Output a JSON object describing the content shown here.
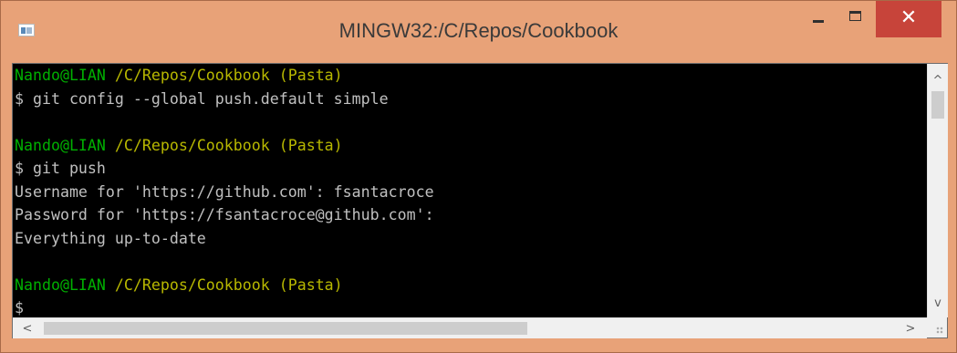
{
  "window": {
    "title": "MINGW32:/C/Repos/Cookbook",
    "icon": "terminal-app-icon",
    "controls": {
      "minimize": "minimize-icon",
      "maximize": "maximize-icon",
      "close": "✕"
    },
    "frame_color": "#e8a278",
    "close_color": "#c7443a"
  },
  "terminal": {
    "prompt_user": "Nando@LIAN",
    "prompt_path": "/C/Repos/Cookbook (Pasta)",
    "lines": [
      {
        "type": "prompt",
        "user": "Nando@LIAN",
        "path": "/C/Repos/Cookbook (Pasta)"
      },
      {
        "type": "text",
        "text": "$ git config --global push.default simple"
      },
      {
        "type": "blank",
        "text": ""
      },
      {
        "type": "prompt",
        "user": "Nando@LIAN",
        "path": "/C/Repos/Cookbook (Pasta)"
      },
      {
        "type": "text",
        "text": "$ git push"
      },
      {
        "type": "text",
        "text": "Username for 'https://github.com': fsantacroce"
      },
      {
        "type": "text",
        "text": "Password for 'https://fsantacroce@github.com':"
      },
      {
        "type": "text",
        "text": "Everything up-to-date"
      },
      {
        "type": "blank",
        "text": ""
      },
      {
        "type": "prompt",
        "user": "Nando@LIAN",
        "path": "/C/Repos/Cookbook (Pasta)"
      },
      {
        "type": "cursor",
        "text": "$"
      }
    ],
    "colors": {
      "background": "#000000",
      "text": "#c0c0c0",
      "user": "#00b000",
      "path": "#b8b800"
    }
  },
  "scrollbars": {
    "up_arrow": "^",
    "down_arrow": "v",
    "left_arrow": "<",
    "right_arrow": ">"
  }
}
